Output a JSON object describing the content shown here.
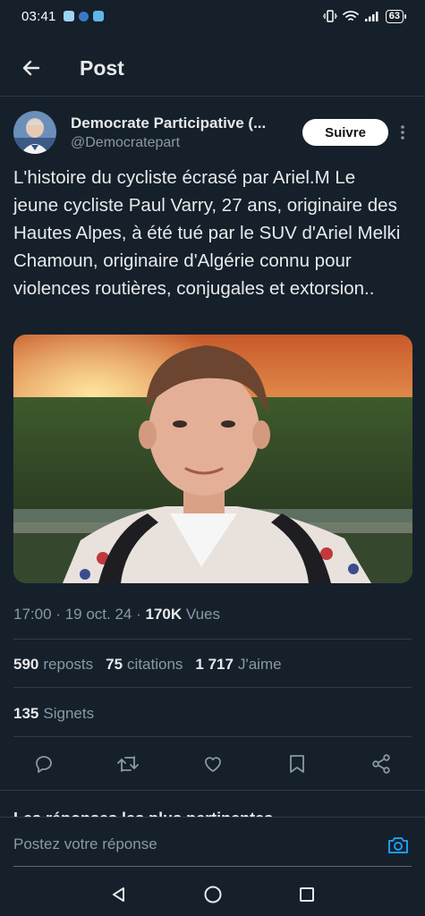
{
  "status_bar": {
    "time": "03:41",
    "battery": "63"
  },
  "header": {
    "title": "Post"
  },
  "author": {
    "name": "Democrate Participative (...",
    "handle": "@Democratepart",
    "follow_label": "Suivre"
  },
  "tweet": {
    "text": "L'histoire du cycliste écrasé par Ariel.M Le jeune cycliste Paul Varry, 27 ans, originaire des Hautes Alpes, à été tué par le SUV d'Ariel Melki Chamoun, originaire d'Algérie connu pour violences routières, conjugales et extorsion.."
  },
  "meta": {
    "time": "17:00",
    "separator": "·",
    "date": "19 oct. 24",
    "views_count": "170K",
    "views_label": "Vues"
  },
  "stats": {
    "reposts_count": "590",
    "reposts_label": "reposts",
    "quotes_count": "75",
    "quotes_label": "citations",
    "likes_count": "1 717",
    "likes_label": "J'aime",
    "bookmarks_count": "135",
    "bookmarks_label": "Signets"
  },
  "actions": [
    "reply-icon",
    "repost-icon",
    "like-icon",
    "bookmark-icon",
    "share-icon"
  ],
  "replies": {
    "heading": "Les réponses les plus pertinentes",
    "chevron": "⌄"
  },
  "composer": {
    "placeholder": "Postez votre réponse"
  },
  "colors": {
    "background": "#15202b",
    "text": "#e7e9ea",
    "muted": "#8b98a5",
    "accent": "#1d9bf0",
    "divider": "#2f3b47"
  }
}
